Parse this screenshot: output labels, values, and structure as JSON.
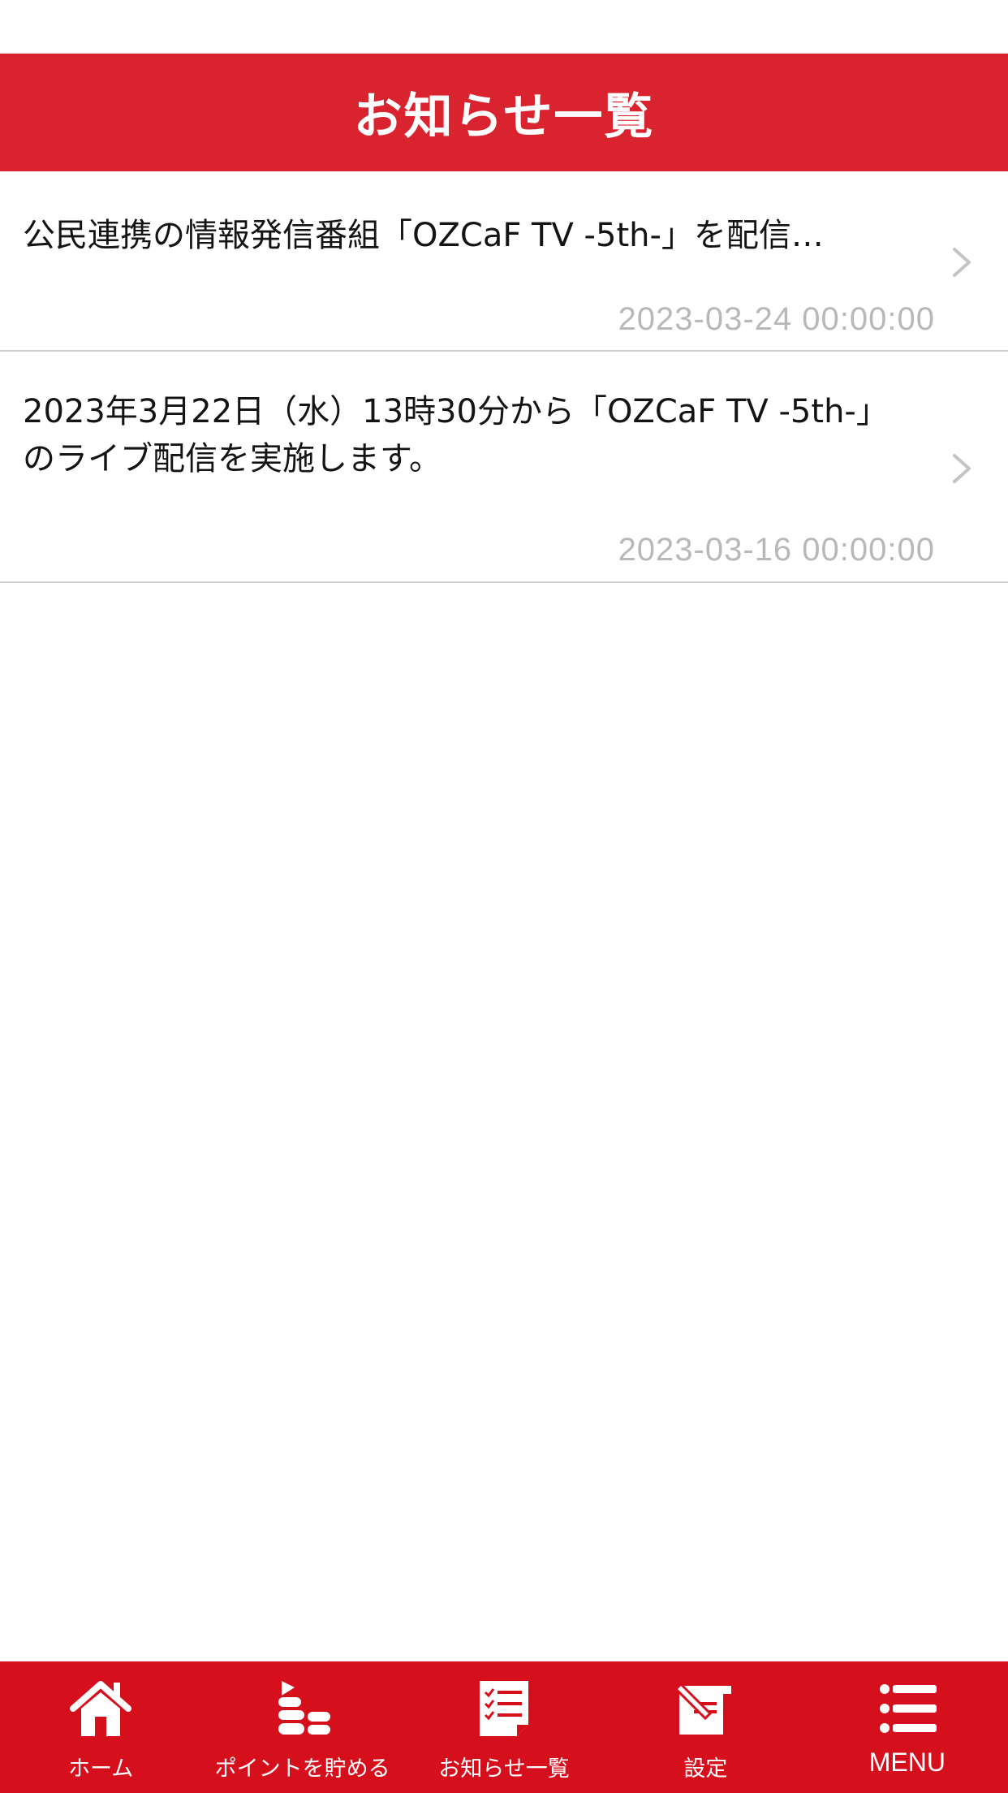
{
  "header": {
    "title": "お知らせ一覧"
  },
  "news": [
    {
      "title": "公民連携の情報発信番組「OZCaF TV -5th-」を配信…",
      "date": "2023-03-24 00:00:00"
    },
    {
      "title": "2023年3月22日（水）13時30分から「OZCaF TV -5th-」のライブ配信を実施します。",
      "date": "2023-03-16 00:00:00"
    }
  ],
  "tabs": [
    {
      "label": "ホーム",
      "icon": "home-icon"
    },
    {
      "label": "ポイントを貯める",
      "icon": "coins-icon"
    },
    {
      "label": "お知らせ一覧",
      "icon": "notice-list-icon"
    },
    {
      "label": "設定",
      "icon": "settings-icon"
    },
    {
      "label": "MENU",
      "icon": "menu-icon"
    }
  ],
  "colors": {
    "header_bg": "#d9232e",
    "tabbar_bg": "#d50f1c",
    "date_text": "#b8b8b8",
    "divider": "#cfcfcf"
  }
}
